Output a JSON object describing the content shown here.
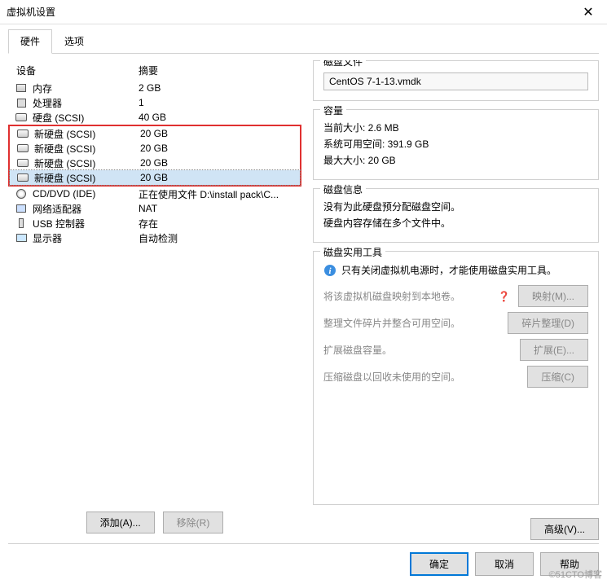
{
  "title": "虚拟机设置",
  "tabs": {
    "hardware": "硬件",
    "options": "选项"
  },
  "headers": {
    "device": "设备",
    "summary": "摘要"
  },
  "devices": [
    {
      "icon": "memory",
      "label": "内存",
      "summary": "2 GB"
    },
    {
      "icon": "cpu",
      "label": "处理器",
      "summary": "1"
    },
    {
      "icon": "disk",
      "label": "硬盘 (SCSI)",
      "summary": "40 GB"
    },
    {
      "icon": "disk",
      "label": "新硬盘 (SCSI)",
      "summary": "20 GB"
    },
    {
      "icon": "disk",
      "label": "新硬盘 (SCSI)",
      "summary": "20 GB"
    },
    {
      "icon": "disk",
      "label": "新硬盘 (SCSI)",
      "summary": "20 GB"
    },
    {
      "icon": "disk",
      "label": "新硬盘 (SCSI)",
      "summary": "20 GB"
    },
    {
      "icon": "cd",
      "label": "CD/DVD (IDE)",
      "summary": "正在使用文件 D:\\install pack\\C..."
    },
    {
      "icon": "net",
      "label": "网络适配器",
      "summary": "NAT"
    },
    {
      "icon": "usb",
      "label": "USB 控制器",
      "summary": "存在"
    },
    {
      "icon": "display",
      "label": "显示器",
      "summary": "自动检测"
    }
  ],
  "buttons": {
    "add": "添加(A)...",
    "remove": "移除(R)",
    "ok": "确定",
    "cancel": "取消",
    "help": "帮助",
    "advanced": "高级(V)...",
    "map": "映射(M)...",
    "defrag": "碎片整理(D)",
    "expand": "扩展(E)...",
    "compact": "压缩(C)"
  },
  "groups": {
    "diskfile": {
      "title": "磁盘文件",
      "value": "CentOS 7-1-13.vmdk"
    },
    "capacity": {
      "title": "容量",
      "current": "当前大小: 2.6 MB",
      "free": "系统可用空间: 391.9 GB",
      "max": "最大大小: 20 GB"
    },
    "diskinfo": {
      "title": "磁盘信息",
      "line1": "没有为此硬盘预分配磁盘空间。",
      "line2": "硬盘内容存储在多个文件中。"
    },
    "tools": {
      "title": "磁盘实用工具",
      "note": "只有关闭虚拟机电源时，才能使用磁盘实用工具。",
      "map_desc": "将该虚拟机磁盘映射到本地卷。",
      "defrag_desc": "整理文件碎片并整合可用空间。",
      "expand_desc": "扩展磁盘容量。",
      "compact_desc": "压缩磁盘以回收未使用的空间。"
    }
  },
  "watermark": "©51CTO博客"
}
